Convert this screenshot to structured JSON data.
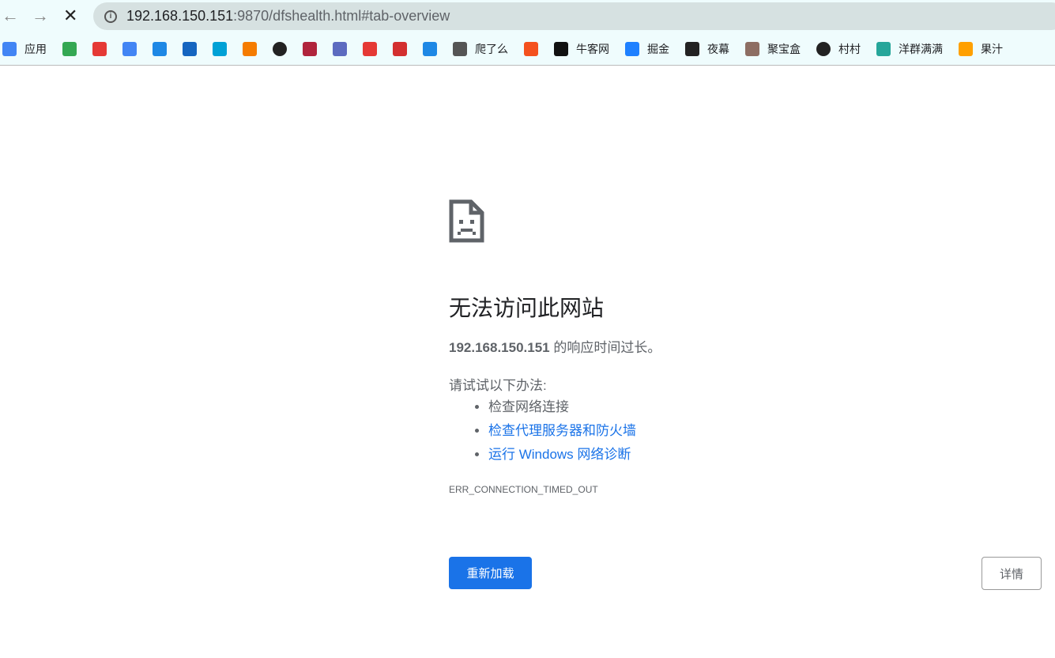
{
  "toolbar": {
    "back": "←",
    "forward": "→",
    "stop": "✕",
    "info": "i",
    "url_host": "192.168.150.151",
    "url_rest": ":9870/dfshealth.html#tab-overview"
  },
  "bookmarks": [
    {
      "label": "应用",
      "icon": "apps-grid-icon",
      "color": "#4285f4"
    },
    {
      "label": "",
      "icon": "google-maps-icon",
      "color": "#34a853"
    },
    {
      "label": "",
      "icon": "y-icon",
      "color": "#e53935"
    },
    {
      "label": "",
      "icon": "google-translate-icon",
      "color": "#4285f4"
    },
    {
      "label": "",
      "icon": "bing-icon",
      "color": "#1e88e5"
    },
    {
      "label": "",
      "icon": "emblem-icon",
      "color": "#1565c0"
    },
    {
      "label": "",
      "icon": "bilibili-icon",
      "color": "#00a1d6"
    },
    {
      "label": "",
      "icon": "zhi-icon",
      "color": "#f57c00"
    },
    {
      "label": "",
      "icon": "github-icon",
      "color": "#222222"
    },
    {
      "label": "",
      "icon": "q-icon",
      "color": "#b0243c"
    },
    {
      "label": "",
      "icon": "circle-icon",
      "color": "#5c6bc0"
    },
    {
      "label": "",
      "icon": "boat-icon",
      "color": "#e53935"
    },
    {
      "label": "",
      "icon": "seal-icon",
      "color": "#d32f2f"
    },
    {
      "label": "",
      "icon": "infinity-icon",
      "color": "#1e88e5"
    },
    {
      "label": "爬了么",
      "icon": "layers-icon",
      "color": "#555555"
    },
    {
      "label": "",
      "icon": "c-icon",
      "color": "#f4511e"
    },
    {
      "label": "牛客网",
      "icon": "nowcoder-icon",
      "color": "#111111"
    },
    {
      "label": "掘金",
      "icon": "juejin-icon",
      "color": "#1e80ff"
    },
    {
      "label": "夜幕",
      "icon": "nt-icon",
      "color": "#222222"
    },
    {
      "label": "聚宝盒",
      "icon": "avatar-icon",
      "color": "#8d6e63"
    },
    {
      "label": "村村",
      "icon": "shield-icon",
      "color": "#222222"
    },
    {
      "label": "洋群满满",
      "icon": "penguin-icon",
      "color": "#26a69a"
    },
    {
      "label": "果汁",
      "icon": "orange-icon",
      "color": "#ffa000"
    }
  ],
  "error": {
    "title": "无法访问此网站",
    "host": "192.168.150.151",
    "message": " 的响应时间过长。",
    "try_label": "请试试以下办法:",
    "suggestions": [
      "检查网络连接",
      "检查代理服务器和防火墙",
      "运行 Windows 网络诊断"
    ],
    "code": "ERR_CONNECTION_TIMED_OUT",
    "reload": "重新加载",
    "details": "详情"
  }
}
